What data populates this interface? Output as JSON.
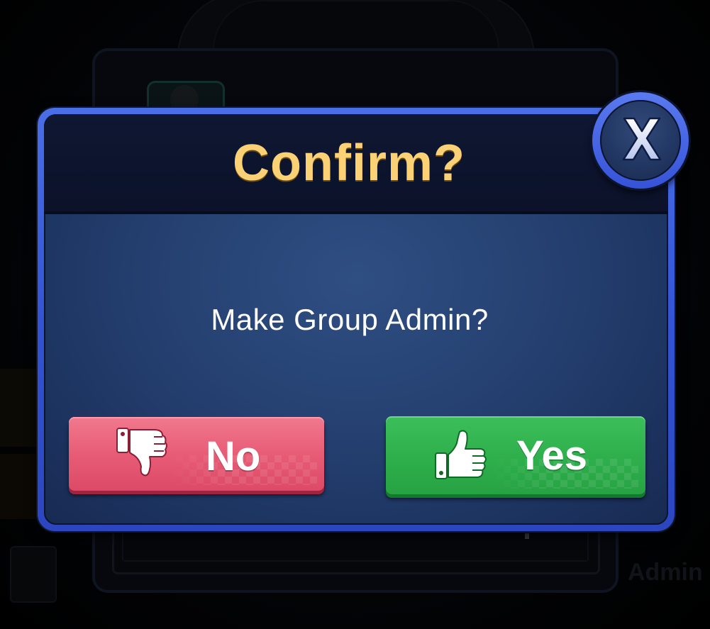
{
  "dialog": {
    "title": "Confirm?",
    "message": "Make Group Admin?",
    "no_button": {
      "label": "No",
      "icon": "thumbs-down-icon",
      "color": "#e85c76"
    },
    "yes_button": {
      "label": "Yes",
      "icon": "thumbs-up-icon",
      "color": "#2fb04d"
    },
    "close_icon": "close-icon",
    "title_color": "#fbd175",
    "frame_color": "#3b5de0"
  },
  "background": {
    "partial_label": "Admin"
  }
}
